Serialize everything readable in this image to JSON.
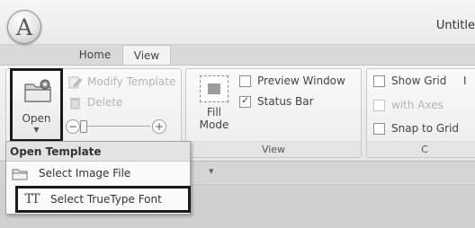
{
  "app": {
    "logo_letter": "A",
    "window_title": "Untitle"
  },
  "tabs": [
    {
      "label": "Home"
    },
    {
      "label": "View"
    }
  ],
  "ribbon": {
    "template_group": {
      "open_label": "Open",
      "modify_template_label": "Modify Template",
      "delete_label": "Delete"
    },
    "view_group": {
      "fill_mode_label_line1": "Fill",
      "fill_mode_label_line2": "Mode",
      "preview_window_label": "Preview Window",
      "preview_window_checked": false,
      "status_bar_label": "Status Bar",
      "status_bar_checked": true,
      "group_label": "View"
    },
    "grid_group": {
      "show_grid_label": "Show Grid",
      "show_grid_checked": false,
      "with_axes_label": "with Axes",
      "with_axes_checked": false,
      "snap_to_grid_label": "Snap to Grid",
      "snap_to_grid_checked": false,
      "truncated_next_label": "I",
      "group_label": "C"
    }
  },
  "open_menu": {
    "header": "Open Template",
    "items": [
      {
        "label": "Select Image File",
        "icon": "folder-icon"
      },
      {
        "label": "Select TrueType Font",
        "icon": "truetype-font-icon"
      }
    ]
  },
  "doc_tab_arrow": "▾",
  "colors": {
    "highlight_border": "#1a1a1a",
    "ribbon_bg": "#f0f0f0",
    "workspace_bg": "#d0d0d0"
  }
}
